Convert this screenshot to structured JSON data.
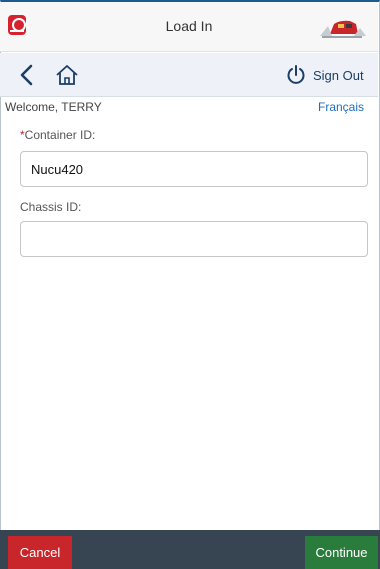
{
  "header": {
    "title": "Load In",
    "app_icon": "cp-app-icon",
    "logo": "train-logo"
  },
  "nav": {
    "back_icon": "chevron-left-icon",
    "home_icon": "home-icon",
    "signout_icon": "power-icon",
    "signout_label": "Sign Out"
  },
  "welcome_text": "Welcome, TERRY",
  "language_link": "Français",
  "form": {
    "container_id": {
      "required_mark": "*",
      "label": "Container ID:",
      "value": "Nucu420"
    },
    "chassis_id": {
      "label": "Chassis ID:",
      "value": ""
    }
  },
  "footer": {
    "cancel_label": "Cancel",
    "continue_label": "Continue"
  },
  "colors": {
    "primary": "#1c5a8f",
    "cancel": "#c8262a",
    "continue": "#2a7c3c",
    "footer_bg": "#374553",
    "link": "#1f6fba"
  }
}
